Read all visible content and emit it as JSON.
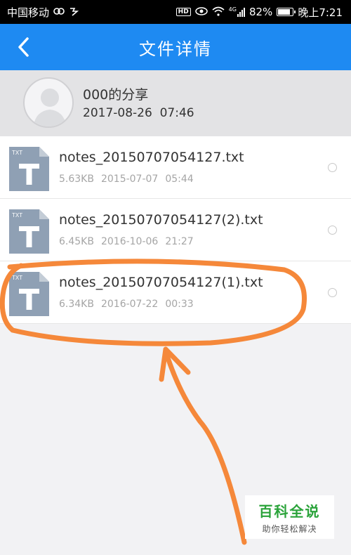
{
  "status_bar": {
    "carrier": "中国移动",
    "network": "4G",
    "battery": "82%",
    "battery_level": 0.82,
    "time": "晚上7:21"
  },
  "header": {
    "title": "文件详情"
  },
  "share": {
    "title": "000的分享",
    "date": "2017-08-26",
    "time": "07:46"
  },
  "files": [
    {
      "name": "notes_20150707054127.txt",
      "size": "5.63KB",
      "date": "2015-07-07",
      "time": "05:44",
      "icon_label": "TXT"
    },
    {
      "name": "notes_20150707054127(2).txt",
      "size": "6.45KB",
      "date": "2016-10-06",
      "time": "21:27",
      "icon_label": "TXT"
    },
    {
      "name": "notes_20150707054127(1).txt",
      "size": "6.34KB",
      "date": "2016-07-22",
      "time": "00:33",
      "icon_label": "TXT"
    }
  ],
  "watermark": {
    "main": "百科全说",
    "sub": "助你轻松解决"
  },
  "colors": {
    "header_bg": "#1e8af2",
    "annotation": "#f5883a",
    "file_icon": "#8fa0b4"
  }
}
